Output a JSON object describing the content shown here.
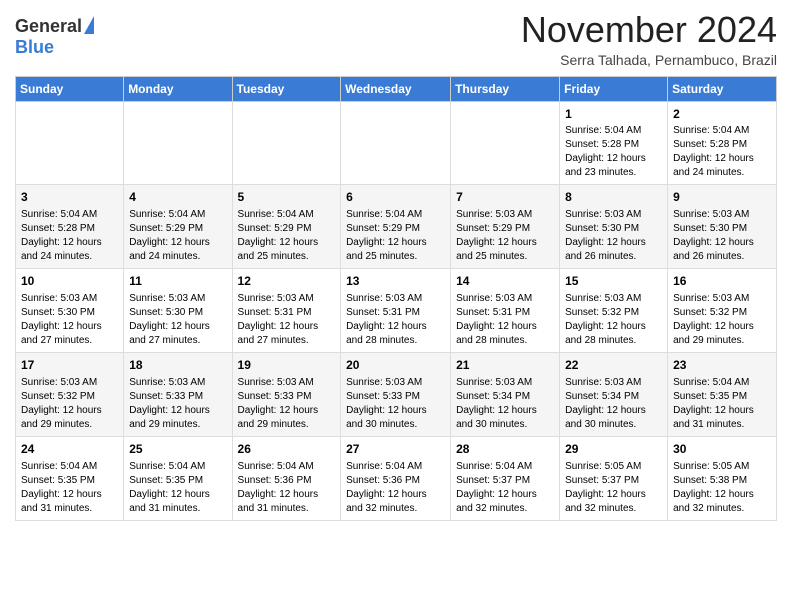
{
  "header": {
    "logo_general": "General",
    "logo_blue": "Blue",
    "month_title": "November 2024",
    "location": "Serra Talhada, Pernambuco, Brazil"
  },
  "days_of_week": [
    "Sunday",
    "Monday",
    "Tuesday",
    "Wednesday",
    "Thursday",
    "Friday",
    "Saturday"
  ],
  "weeks": [
    [
      {
        "day": "",
        "info": ""
      },
      {
        "day": "",
        "info": ""
      },
      {
        "day": "",
        "info": ""
      },
      {
        "day": "",
        "info": ""
      },
      {
        "day": "",
        "info": ""
      },
      {
        "day": "1",
        "info": "Sunrise: 5:04 AM\nSunset: 5:28 PM\nDaylight: 12 hours and 23 minutes."
      },
      {
        "day": "2",
        "info": "Sunrise: 5:04 AM\nSunset: 5:28 PM\nDaylight: 12 hours and 24 minutes."
      }
    ],
    [
      {
        "day": "3",
        "info": "Sunrise: 5:04 AM\nSunset: 5:28 PM\nDaylight: 12 hours and 24 minutes."
      },
      {
        "day": "4",
        "info": "Sunrise: 5:04 AM\nSunset: 5:29 PM\nDaylight: 12 hours and 24 minutes."
      },
      {
        "day": "5",
        "info": "Sunrise: 5:04 AM\nSunset: 5:29 PM\nDaylight: 12 hours and 25 minutes."
      },
      {
        "day": "6",
        "info": "Sunrise: 5:04 AM\nSunset: 5:29 PM\nDaylight: 12 hours and 25 minutes."
      },
      {
        "day": "7",
        "info": "Sunrise: 5:03 AM\nSunset: 5:29 PM\nDaylight: 12 hours and 25 minutes."
      },
      {
        "day": "8",
        "info": "Sunrise: 5:03 AM\nSunset: 5:30 PM\nDaylight: 12 hours and 26 minutes."
      },
      {
        "day": "9",
        "info": "Sunrise: 5:03 AM\nSunset: 5:30 PM\nDaylight: 12 hours and 26 minutes."
      }
    ],
    [
      {
        "day": "10",
        "info": "Sunrise: 5:03 AM\nSunset: 5:30 PM\nDaylight: 12 hours and 27 minutes."
      },
      {
        "day": "11",
        "info": "Sunrise: 5:03 AM\nSunset: 5:30 PM\nDaylight: 12 hours and 27 minutes."
      },
      {
        "day": "12",
        "info": "Sunrise: 5:03 AM\nSunset: 5:31 PM\nDaylight: 12 hours and 27 minutes."
      },
      {
        "day": "13",
        "info": "Sunrise: 5:03 AM\nSunset: 5:31 PM\nDaylight: 12 hours and 28 minutes."
      },
      {
        "day": "14",
        "info": "Sunrise: 5:03 AM\nSunset: 5:31 PM\nDaylight: 12 hours and 28 minutes."
      },
      {
        "day": "15",
        "info": "Sunrise: 5:03 AM\nSunset: 5:32 PM\nDaylight: 12 hours and 28 minutes."
      },
      {
        "day": "16",
        "info": "Sunrise: 5:03 AM\nSunset: 5:32 PM\nDaylight: 12 hours and 29 minutes."
      }
    ],
    [
      {
        "day": "17",
        "info": "Sunrise: 5:03 AM\nSunset: 5:32 PM\nDaylight: 12 hours and 29 minutes."
      },
      {
        "day": "18",
        "info": "Sunrise: 5:03 AM\nSunset: 5:33 PM\nDaylight: 12 hours and 29 minutes."
      },
      {
        "day": "19",
        "info": "Sunrise: 5:03 AM\nSunset: 5:33 PM\nDaylight: 12 hours and 29 minutes."
      },
      {
        "day": "20",
        "info": "Sunrise: 5:03 AM\nSunset: 5:33 PM\nDaylight: 12 hours and 30 minutes."
      },
      {
        "day": "21",
        "info": "Sunrise: 5:03 AM\nSunset: 5:34 PM\nDaylight: 12 hours and 30 minutes."
      },
      {
        "day": "22",
        "info": "Sunrise: 5:03 AM\nSunset: 5:34 PM\nDaylight: 12 hours and 30 minutes."
      },
      {
        "day": "23",
        "info": "Sunrise: 5:04 AM\nSunset: 5:35 PM\nDaylight: 12 hours and 31 minutes."
      }
    ],
    [
      {
        "day": "24",
        "info": "Sunrise: 5:04 AM\nSunset: 5:35 PM\nDaylight: 12 hours and 31 minutes."
      },
      {
        "day": "25",
        "info": "Sunrise: 5:04 AM\nSunset: 5:35 PM\nDaylight: 12 hours and 31 minutes."
      },
      {
        "day": "26",
        "info": "Sunrise: 5:04 AM\nSunset: 5:36 PM\nDaylight: 12 hours and 31 minutes."
      },
      {
        "day": "27",
        "info": "Sunrise: 5:04 AM\nSunset: 5:36 PM\nDaylight: 12 hours and 32 minutes."
      },
      {
        "day": "28",
        "info": "Sunrise: 5:04 AM\nSunset: 5:37 PM\nDaylight: 12 hours and 32 minutes."
      },
      {
        "day": "29",
        "info": "Sunrise: 5:05 AM\nSunset: 5:37 PM\nDaylight: 12 hours and 32 minutes."
      },
      {
        "day": "30",
        "info": "Sunrise: 5:05 AM\nSunset: 5:38 PM\nDaylight: 12 hours and 32 minutes."
      }
    ]
  ]
}
